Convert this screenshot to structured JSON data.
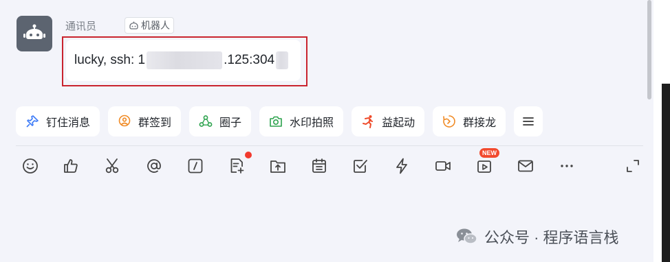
{
  "message": {
    "sender": "通讯员",
    "bot_badge": "机器人",
    "text_prefix": "lucky, ssh: 1",
    "text_middle": ".125:304"
  },
  "chips": [
    {
      "label": "钉住消息",
      "icon": "pin-icon",
      "color": "#3d7bf7"
    },
    {
      "label": "群签到",
      "icon": "checkin-location-icon",
      "color": "#f08a24"
    },
    {
      "label": "圈子",
      "icon": "circle-nodes-icon",
      "color": "#2ba24c"
    },
    {
      "label": "水印拍照",
      "icon": "camera-icon",
      "color": "#2ba24c"
    },
    {
      "label": "益起动",
      "icon": "runner-icon",
      "color": "#ef4b2a"
    },
    {
      "label": "群接龙",
      "icon": "relay-icon",
      "color": "#f08a24"
    }
  ],
  "toolbar": {
    "icons": [
      "emoji-icon",
      "thumbs-up-icon",
      "scissors-icon",
      "at-icon",
      "slash-command-icon",
      "add-document-icon",
      "upload-file-icon",
      "calendar-icon",
      "checkbox-icon",
      "lightning-icon",
      "video-call-icon",
      "live-video-icon",
      "mail-icon",
      "more-icon",
      "expand-icon"
    ],
    "new_badge": "NEW"
  },
  "watermark": "公众号 · 程序语言栈"
}
